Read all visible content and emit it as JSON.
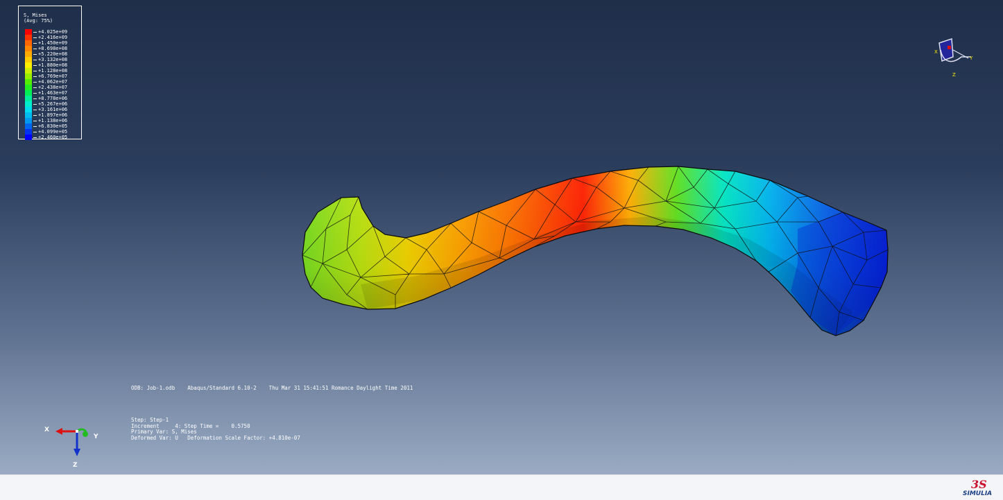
{
  "legend": {
    "title": "S, Mises",
    "subtitle": "(Avg: 75%)",
    "entries": [
      {
        "value": "+4.025e+09",
        "color": "#ff0000"
      },
      {
        "value": "+2.416e+09",
        "color": "#ff3300"
      },
      {
        "value": "+1.450e+09",
        "color": "#ff6600"
      },
      {
        "value": "+8.698e+08",
        "color": "#ff8800"
      },
      {
        "value": "+5.220e+08",
        "color": "#ffaa00"
      },
      {
        "value": "+3.132e+08",
        "color": "#ffcc00"
      },
      {
        "value": "+1.880e+08",
        "color": "#ffee00"
      },
      {
        "value": "+1.128e+08",
        "color": "#ccee00"
      },
      {
        "value": "+6.769e+07",
        "color": "#99ee00"
      },
      {
        "value": "+4.062e+07",
        "color": "#55ee00"
      },
      {
        "value": "+2.438e+07",
        "color": "#22ee22"
      },
      {
        "value": "+1.463e+07",
        "color": "#00ee55"
      },
      {
        "value": "+8.778e+06",
        "color": "#00ee99"
      },
      {
        "value": "+5.267e+06",
        "color": "#00eecc"
      },
      {
        "value": "+3.161e+06",
        "color": "#00ddee"
      },
      {
        "value": "+1.897e+06",
        "color": "#00bbee"
      },
      {
        "value": "+1.138e+06",
        "color": "#0099ee"
      },
      {
        "value": "+6.830e+05",
        "color": "#0066ee"
      },
      {
        "value": "+4.099e+05",
        "color": "#0033ee"
      },
      {
        "value": "+2.460e+05",
        "color": "#0000ff"
      }
    ]
  },
  "info": {
    "odb_line": "ODB: Job-1.odb    Abaqus/Standard 6.10-2    Thu Mar 31 15:41:51 Romance Daylight Time 2011",
    "step": "Step: Step-1",
    "increment": "Increment     4: Step Time =    0.5750",
    "primary_var": "Primary Var: S, Mises",
    "deformed_var": "Deformed Var: U   Deformation Scale Factor: +4.810e-07"
  },
  "triad": {
    "x_label": "X",
    "y_label": "Y",
    "z_label": "Z"
  },
  "view_cube": {
    "x_label": "X",
    "y_label": "Y",
    "z_label": "Z"
  },
  "brand": {
    "name": "SIMULIA",
    "logo_mark": "3S",
    "icon": "3ds-logo-icon"
  }
}
